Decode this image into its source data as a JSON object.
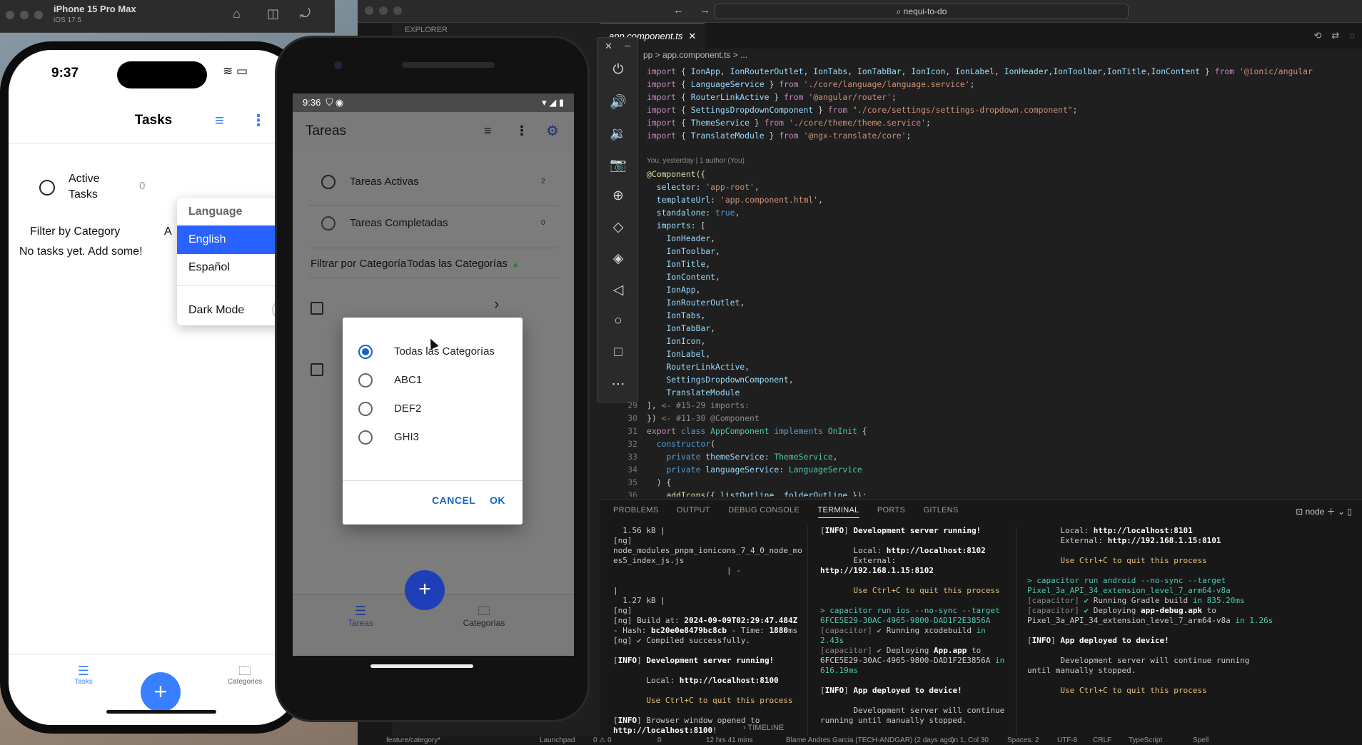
{
  "simulator": {
    "device_name": "iPhone 15 Pro Max",
    "os": "iOS 17.5"
  },
  "ios_app": {
    "time": "9:37",
    "title": "Tasks",
    "active_label": "Active Tasks",
    "active_count": "0",
    "filter_label": "Filter by Category",
    "filter_value": "A",
    "empty_text": "No tasks yet. Add some!",
    "tab_tasks": "Tasks",
    "tab_categories": "Categories",
    "fab": "+",
    "dropdown": {
      "header": "Language",
      "selected": "English",
      "other": "Español",
      "dark_mode": "Dark Mode"
    }
  },
  "android_app": {
    "time": "9:36",
    "title": "Tareas",
    "rows": [
      {
        "label": "Tareas Activas",
        "count": "2"
      },
      {
        "label": "Tareas Completadas",
        "count": "0"
      }
    ],
    "filter_label": "Filtrar por Categoría",
    "filter_value": "Todas las Categorías",
    "tab_tasks": "Tareas",
    "tab_categories": "Categorías",
    "fab": "+",
    "dialog": {
      "options": [
        "Todas las Categorías",
        "ABC1",
        "DEF2",
        "GHI3"
      ],
      "selected_index": 0,
      "cancel": "CANCEL",
      "ok": "OK"
    }
  },
  "vscode": {
    "search": "nequi-to-do",
    "explorer": "EXPLORER",
    "tab": "app.component.ts",
    "breadcrumb": "pp  >  app.component.ts  >  ...",
    "blame": "You, yesterday | 1 author (You)",
    "panel_tabs": [
      "PROBLEMS",
      "OUTPUT",
      "DEBUG CONSOLE",
      "TERMINAL",
      "PORTS",
      "GITLENS"
    ],
    "active_panel": "TERMINAL",
    "terminal_name": "node",
    "timeline": "TIMELINE",
    "status": {
      "branch": "feature/category*",
      "launchpad": "Launchpad",
      "errors": "0 ⚠ 0",
      "warnings": "0",
      "time": "12 hrs 41 mins",
      "blame": "Blame Andres Garcia (TECH-ANDGAR) (2 days ago)",
      "position": "Ln 1, Col 30",
      "spaces": "Spaces: 2",
      "encoding": "UTF-8",
      "eol": "CRLF",
      "language": "TypeScript",
      "spell": "Spell"
    }
  }
}
